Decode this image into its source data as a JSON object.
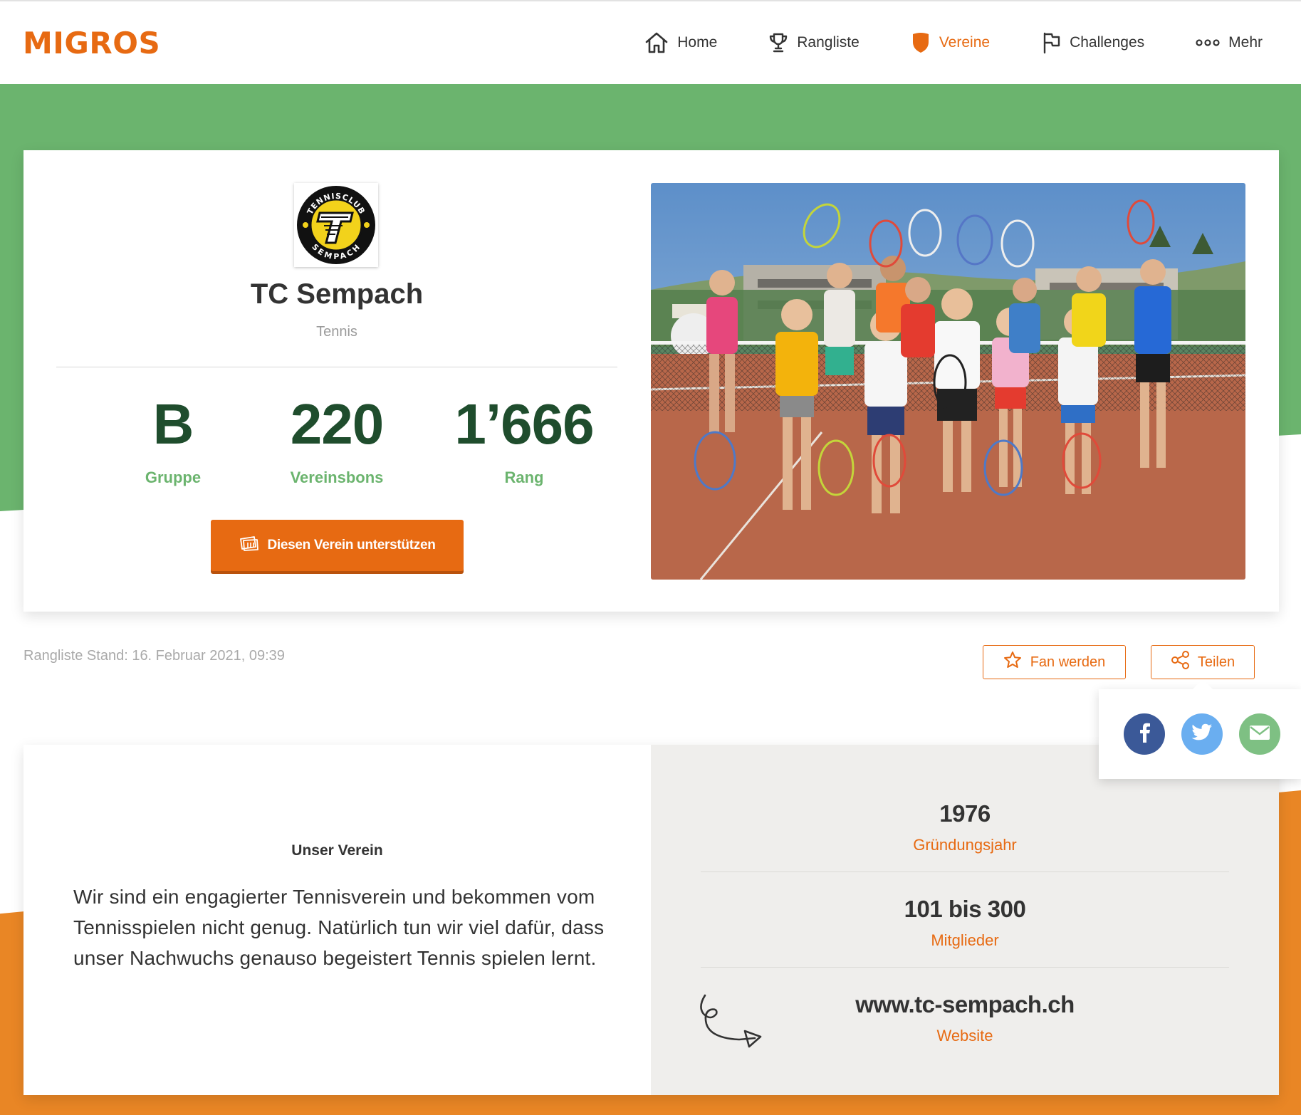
{
  "header": {
    "logo": "MIGROS",
    "nav": [
      {
        "label": "Home",
        "icon": "home-icon"
      },
      {
        "label": "Rangliste",
        "icon": "trophy-icon"
      },
      {
        "label": "Vereine",
        "icon": "shield-icon",
        "active": true
      },
      {
        "label": "Challenges",
        "icon": "flag-icon"
      },
      {
        "label": "Mehr",
        "icon": "more-dots-icon"
      }
    ]
  },
  "club": {
    "name": "TC Sempach",
    "sport": "Tennis",
    "logo_text_top": "TENNISCLUB",
    "logo_text_bottom": "SEMPACH",
    "stats": [
      {
        "value": "B",
        "label": "Gruppe"
      },
      {
        "value": "220",
        "label": "Vereinsbons"
      },
      {
        "value": "1’666",
        "label": "Rang"
      }
    ],
    "support_label": "Diesen Verein unterstützen"
  },
  "ranking_date": "Rangliste Stand: 16. Februar 2021, 09:39",
  "actions": {
    "fan_label": "Fan werden",
    "share_label": "Teilen"
  },
  "share_options": [
    "facebook-icon",
    "twitter-icon",
    "email-icon"
  ],
  "about": {
    "heading": "Unser Verein",
    "text": "Wir sind ein engagierter Tennisverein und bekommen vom Tennisspielen nicht genug. Natürlich tun wir viel dafür, dass unser Nachwuchs genauso begeistert Tennis spielen lernt."
  },
  "facts": [
    {
      "value": "1976",
      "label": "Gründungsjahr"
    },
    {
      "value": "101 bis 300",
      "label": "Mitglieder"
    },
    {
      "value": "www.tc-sempach.ch",
      "label": "Website"
    }
  ],
  "colors": {
    "brand": "#e76a12",
    "green": "#6bb46e",
    "dark_green": "#1f4d2d",
    "facebook": "#3b5998",
    "twitter": "#6aaef0",
    "email": "#7ec083"
  }
}
